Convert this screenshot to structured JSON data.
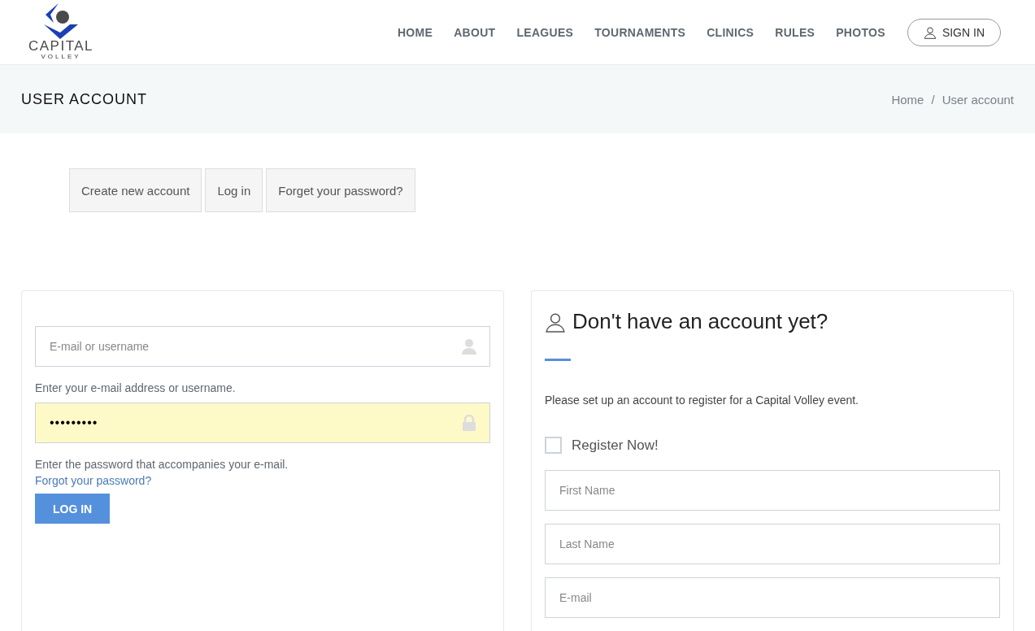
{
  "logo": {
    "name": "CAPITAL",
    "sub": "VOLLEY"
  },
  "nav": {
    "items": [
      "HOME",
      "ABOUT",
      "LEAGUES",
      "TOURNAMENTS",
      "CLINICS",
      "RULES",
      "PHOTOS"
    ],
    "sign_in": "SIGN IN"
  },
  "banner": {
    "title": "USER ACCOUNT",
    "breadcrumb": [
      "Home",
      "User account"
    ],
    "separator": "/"
  },
  "tabs": [
    "Create new account",
    "Log in",
    "Forget your password?"
  ],
  "login": {
    "username": {
      "placeholder": "E-mail or username"
    },
    "username_help": "Enter your e-mail address or username.",
    "password": {
      "value": "•••••••••",
      "autofilled": true
    },
    "password_help": "Enter the password that accompanies your e-mail.",
    "forgot_link": "Forgot your password?",
    "button": "LOG IN"
  },
  "register": {
    "title": "Don't have an account yet?",
    "text": "Please set up an account to register for a Capital Volley event.",
    "checkbox": {
      "label": "Register Now!",
      "checked": false
    },
    "fields": [
      {
        "placeholder": "First Name"
      },
      {
        "placeholder": "Last Name"
      },
      {
        "placeholder": "E-mail"
      }
    ]
  }
}
